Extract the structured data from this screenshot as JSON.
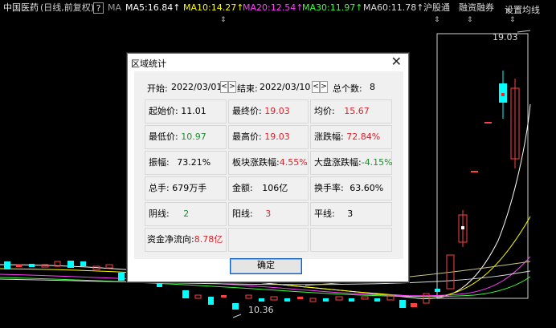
{
  "header": {
    "stock_name": "中国医药",
    "mode": "(日线,前复权)",
    "help": "?",
    "ma_label": "MA",
    "ma5": "MA5:16.84↑",
    "ma10": "MA10:14.27↑",
    "ma20": "MA20:12.54↑",
    "ma30": "MA30:11.97↑",
    "ma60": "MA60:11.78↑",
    "menu_hgt": "沪股通",
    "menu_rzrq": "融资融券",
    "menu_ma": "设置均线"
  },
  "chart": {
    "high_label": "19.03",
    "low_label": "10.36"
  },
  "dialog": {
    "title": "区域统计",
    "close": "✕",
    "start_label": "开始:",
    "start_date": "2022/03/01",
    "end_label": "结束:",
    "end_date": "2022/03/10",
    "prev": "<",
    "next": ">",
    "count_label": "总个数:",
    "count_value": "8",
    "stats": {
      "open_label": "起始价:",
      "open_value": "11.01",
      "close_label": "最终价:",
      "close_value": "19.03",
      "avg_label": "均价:",
      "avg_value": "15.67",
      "low_label": "最低价:",
      "low_value": "10.97",
      "high_label": "最高价:",
      "high_value": "19.03",
      "chg_label": "涨跌幅:",
      "chg_value": "72.84%",
      "amp_label": "振幅:",
      "amp_value": "73.21%",
      "sector_label": "板块涨跌幅:",
      "sector_value": "4.55%",
      "market_label": "大盘涨跌幅:",
      "market_value": "-4.15%",
      "vol_label": "总手:",
      "vol_value": "679万手",
      "amt_label": "金额:",
      "amt_value": "106亿",
      "turnover_label": "换手率:",
      "turnover_value": "63.60%",
      "down_label": "阴线:",
      "down_value": "2",
      "up_label": "阳线:",
      "up_value": "3",
      "flat_label": "平线:",
      "flat_value": "3",
      "flow_label": "资金净流向:",
      "flow_value": "8.78亿"
    },
    "ok": "确定"
  }
}
